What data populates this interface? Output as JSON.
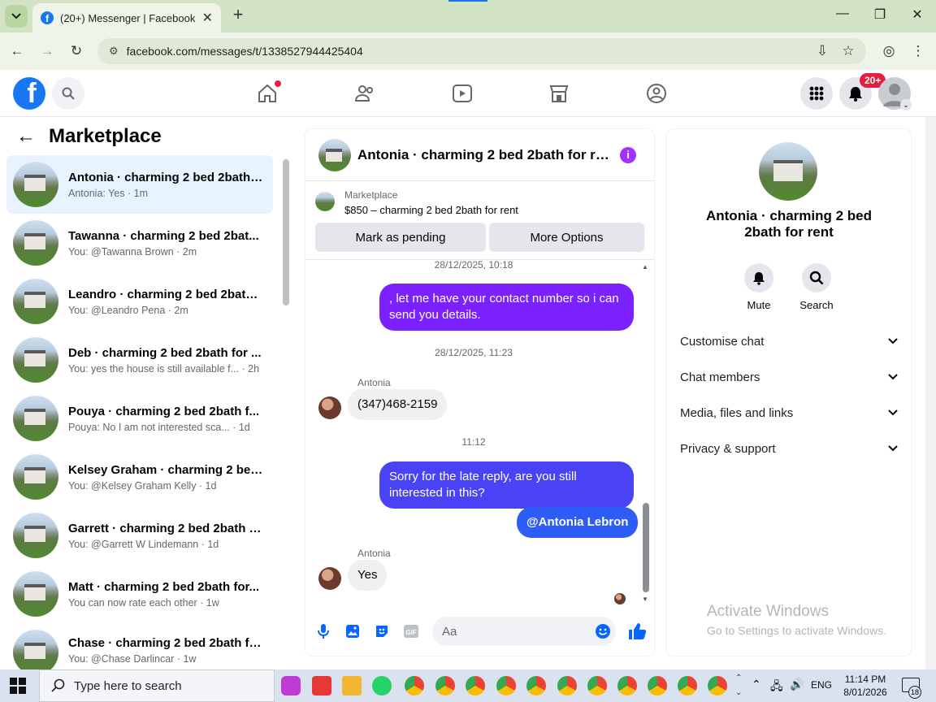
{
  "browser": {
    "tab_title": "(20+) Messenger | Facebook",
    "url": "facebook.com/messages/t/1338527944425404"
  },
  "fb": {
    "notifications_badge": "20+",
    "brand_color": "#1877f2"
  },
  "left_panel": {
    "title": "Marketplace",
    "conversations": [
      {
        "name": "Antonia · charming 2 bed 2bath ...",
        "preview": "Antonia: Yes · 1m",
        "active": true
      },
      {
        "name": "Tawanna · charming 2 bed 2bat...",
        "preview": "You: @Tawanna Brown · 2m"
      },
      {
        "name": "Leandro · charming 2 bed 2bath...",
        "preview": "You: @Leandro Pena · 2m"
      },
      {
        "name": "Deb · charming 2 bed 2bath for ...",
        "preview": "You: yes the house is still available f... · 2h"
      },
      {
        "name": "Pouya · charming 2 bed 2bath f...",
        "preview": "Pouya: No I am not interested sca... · 1d"
      },
      {
        "name": "Kelsey Graham · charming 2 bed...",
        "preview": "You: @Kelsey Graham Kelly · 1d"
      },
      {
        "name": "Garrett · charming 2 bed 2bath f...",
        "preview": "You: @Garrett W Lindemann · 1d"
      },
      {
        "name": "Matt · charming 2 bed 2bath for...",
        "preview": "You can now rate each other · 1w"
      },
      {
        "name": "Chase · charming 2 bed 2bath fo...",
        "preview": "You: @Chase Darlincar · 1w"
      }
    ]
  },
  "chat": {
    "title": "Antonia · charming 2 bed 2bath for re...",
    "marketplace_label": "Marketplace",
    "listing": "$850 – charming 2 bed 2bath for rent",
    "mark_pending": "Mark as pending",
    "more_options": "More Options",
    "ts1": "28/12/2025, 10:18",
    "msg1": ", let me have your contact number so i can send you details.",
    "ts2": "28/12/2025, 11:23",
    "sender1": "Antonia",
    "msg2": "(347)468-2159",
    "ts3": "11:12",
    "msg3": "Sorry for the late reply, are you still interested in this?",
    "msg4": "@Antonia Lebron",
    "sender2": "Antonia",
    "msg5": "Yes",
    "input_placeholder": "Aa",
    "accent": "#7b21ff"
  },
  "right_panel": {
    "title": "Antonia · charming 2 bed 2bath for rent",
    "mute": "Mute",
    "search": "Search",
    "rows": [
      "Customise chat",
      "Chat members",
      "Media, files and links",
      "Privacy & support"
    ]
  },
  "watermark": {
    "line1": "Activate Windows",
    "line2": "Go to Settings to activate Windows."
  },
  "taskbar": {
    "search_placeholder": "Type here to search",
    "lang": "ENG",
    "time": "11:14 PM",
    "date": "8/01/2026",
    "notif_count": "18"
  }
}
